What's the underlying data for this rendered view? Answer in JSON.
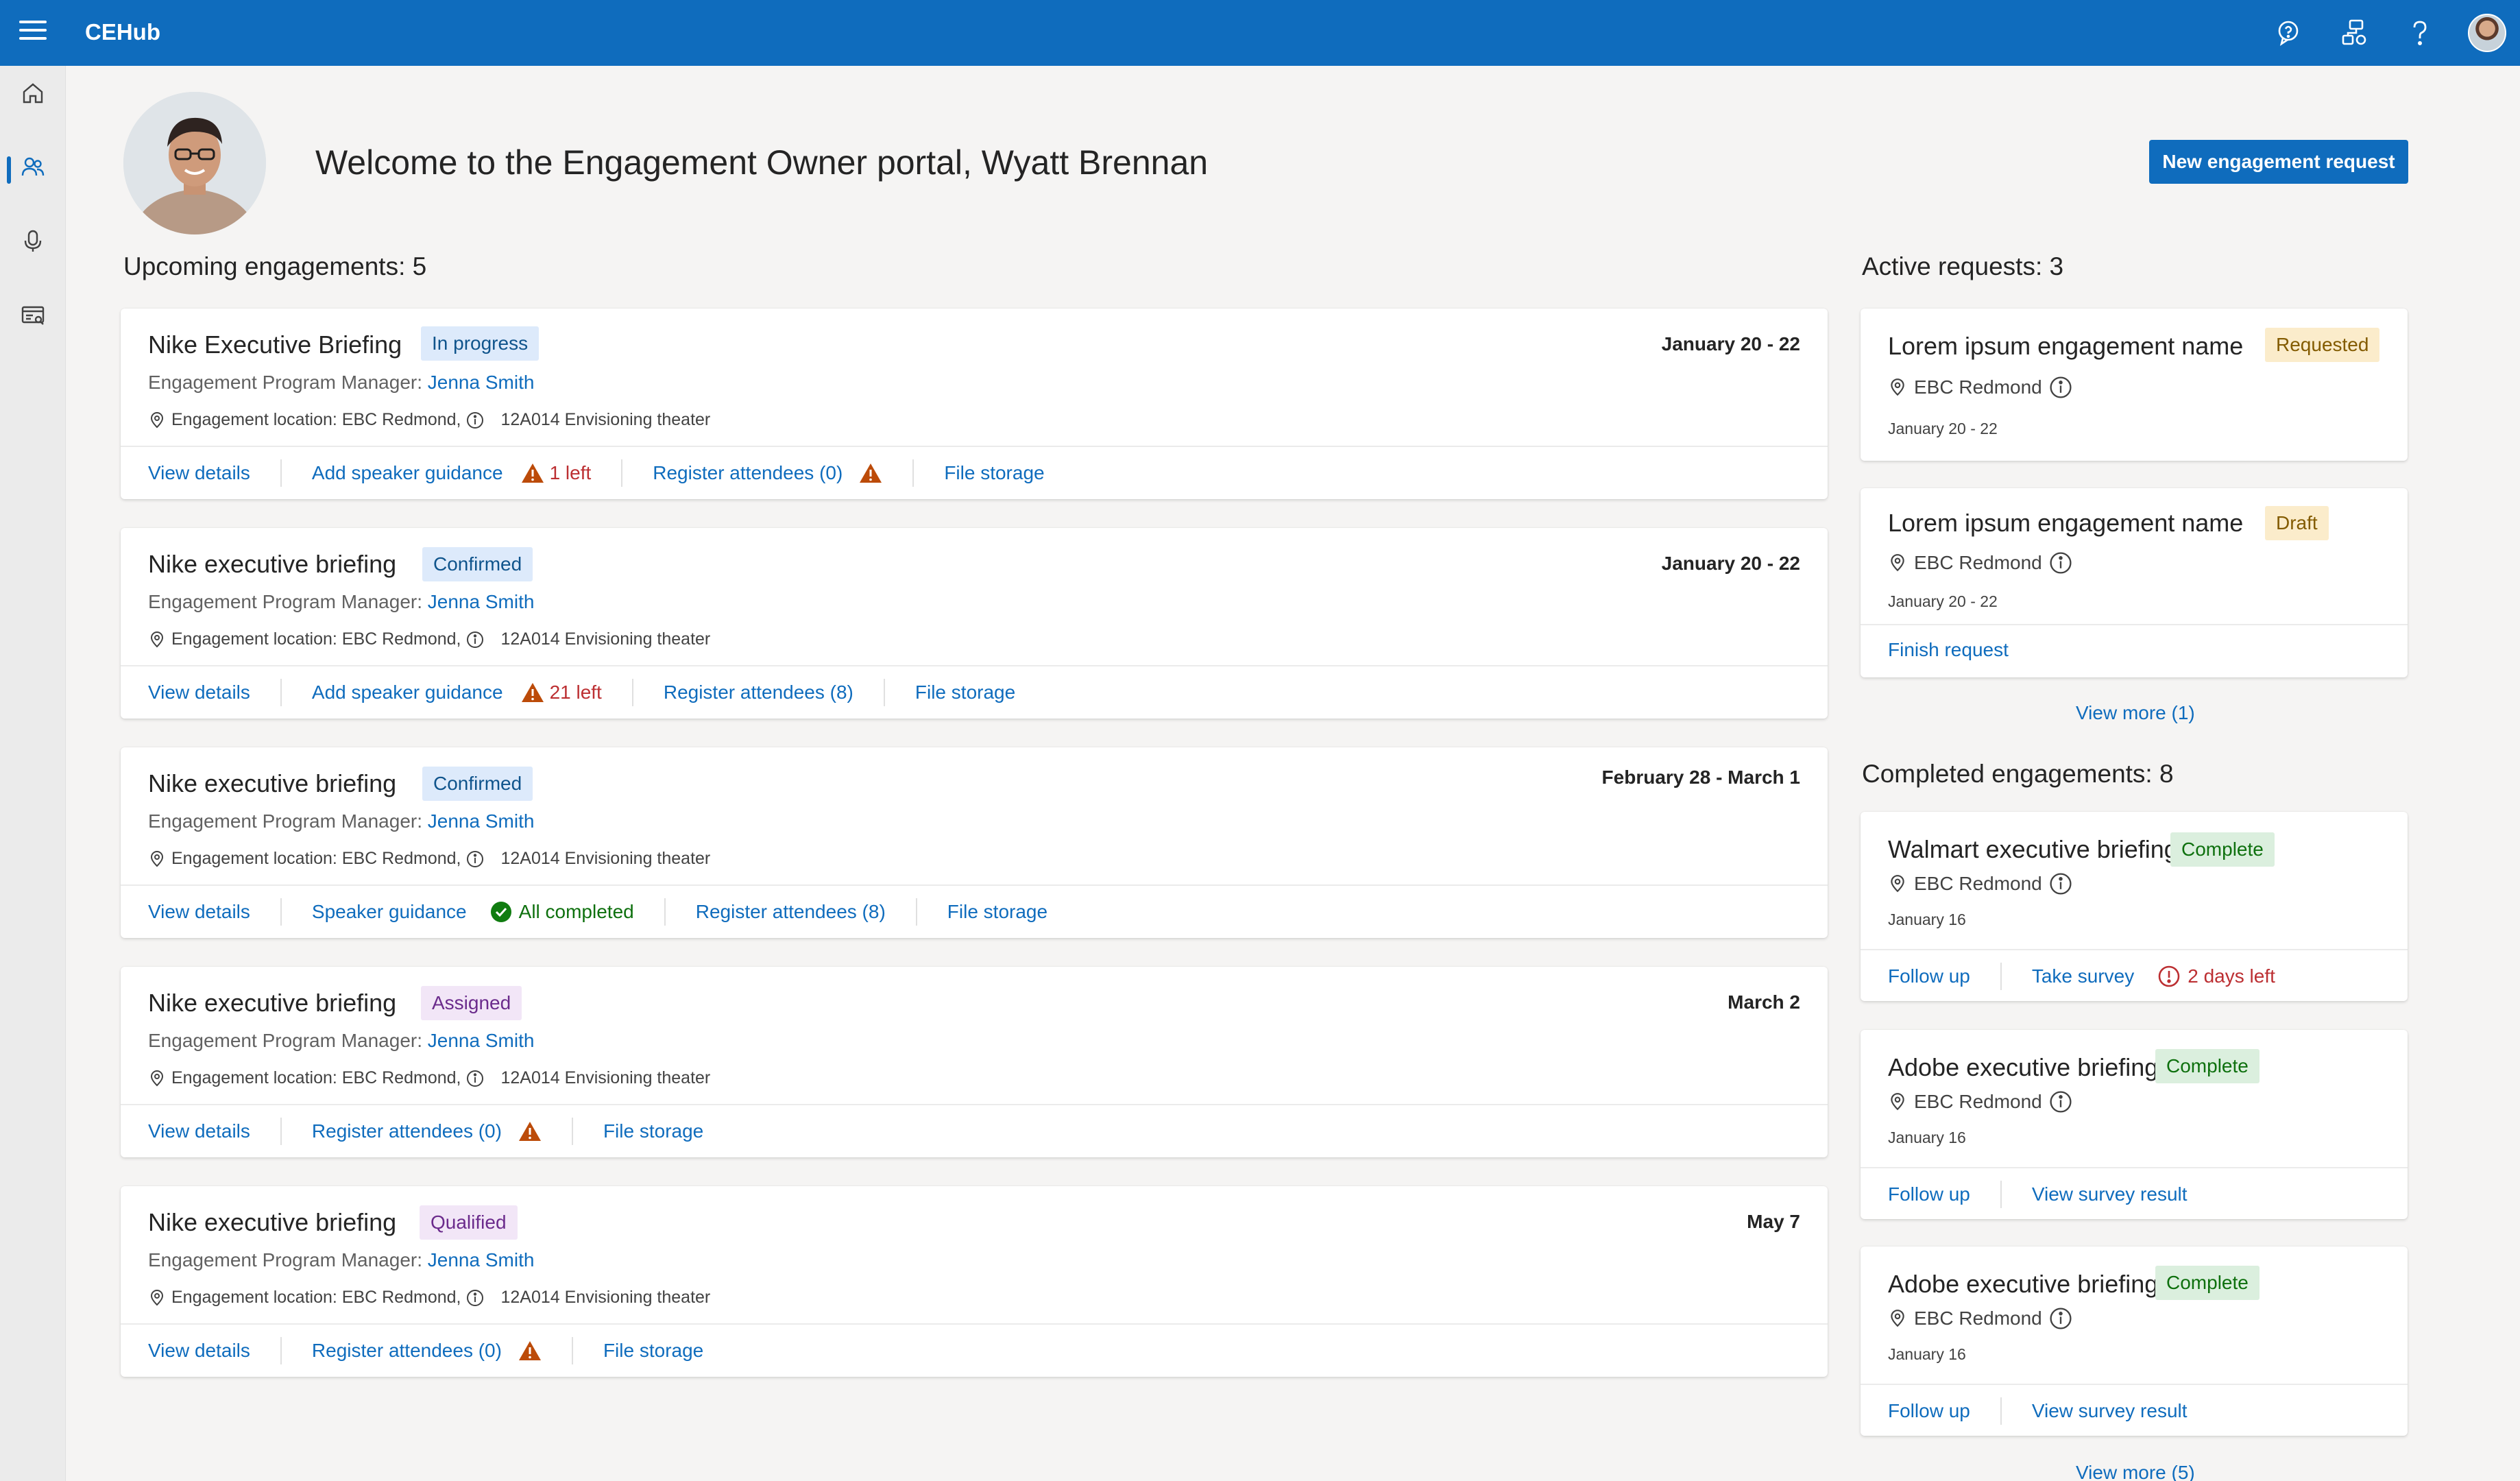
{
  "header": {
    "app_title": "CEHub",
    "icons": [
      "hamburger-icon",
      "chat-help-icon",
      "org-icon",
      "question-icon",
      "avatar"
    ]
  },
  "nav": {
    "items": [
      "home-icon",
      "people-icon",
      "microphone-icon",
      "board-icon"
    ],
    "selected": 1
  },
  "hero": {
    "welcome": "Welcome to the Engagement Owner portal, Wyatt Brennan",
    "new_request_label": "New engagement request"
  },
  "upcoming": {
    "heading": "Upcoming engagements: 5",
    "cards": [
      {
        "title": "Nike Executive Briefing",
        "status": "In progress",
        "date": "January 20 - 22",
        "pm_label": "Engagement Program Manager: ",
        "pm_name": "Jenna Smith",
        "loc_a": "Engagement location: EBC Redmond,",
        "loc_b": "12A014 Envisioning theater",
        "a_details": "View details",
        "a_guidance": "Add speaker guidance",
        "guidance_note": "1 left",
        "a_register": "Register attendees (0)",
        "a_storage": "File storage"
      },
      {
        "title": "Nike executive briefing",
        "status": "Confirmed",
        "date": "January 20 - 22",
        "pm_label": "Engagement Program Manager: ",
        "pm_name": "Jenna Smith",
        "loc_a": "Engagement location: EBC Redmond,",
        "loc_b": "12A014 Envisioning theater",
        "a_details": "View details",
        "a_guidance": "Add speaker guidance",
        "guidance_note": "21 left",
        "a_register": "Register attendees (8)",
        "a_storage": "File storage"
      },
      {
        "title": "Nike executive briefing",
        "status": "Confirmed",
        "date": "February 28 - March 1",
        "pm_label": "Engagement Program Manager: ",
        "pm_name": "Jenna Smith",
        "loc_a": "Engagement location: EBC Redmond,",
        "loc_b": "12A014 Envisioning theater",
        "a_details": "View details",
        "a_guidance": "Speaker guidance",
        "guidance_ok": "All completed",
        "a_register": "Register attendees (8)",
        "a_storage": "File storage"
      },
      {
        "title": "Nike executive briefing",
        "status": "Assigned",
        "date": "March 2",
        "pm_label": "Engagement Program Manager: ",
        "pm_name": "Jenna Smith",
        "loc_a": "Engagement location: EBC Redmond,",
        "loc_b": "12A014 Envisioning theater",
        "a_details": "View details",
        "a_register": "Register attendees (0)",
        "a_storage": "File storage"
      },
      {
        "title": "Nike executive briefing",
        "status": "Qualified",
        "date": "May 7",
        "pm_label": "Engagement Program Manager: ",
        "pm_name": "Jenna Smith",
        "loc_a": "Engagement location: EBC Redmond,",
        "loc_b": "12A014 Envisioning theater",
        "a_details": "View details",
        "a_register": "Register attendees (0)",
        "a_storage": "File storage"
      }
    ]
  },
  "active": {
    "heading": "Active requests: 3",
    "cards": [
      {
        "title": "Lorem ipsum engagement name",
        "status": "Requested",
        "location": "EBC Redmond",
        "date": "January 20 - 22"
      },
      {
        "title": "Lorem ipsum engagement name",
        "status": "Draft",
        "location": "EBC Redmond",
        "date": "January 20 - 22",
        "action": "Finish request"
      }
    ],
    "view_more": "View more (1)"
  },
  "completed": {
    "heading": "Completed engagements: 8",
    "cards": [
      {
        "title": "Walmart executive briefing",
        "status": "Complete",
        "location": "EBC Redmond",
        "date": "January 16",
        "a1": "Follow up",
        "a2": "Take survey",
        "note": "2 days left"
      },
      {
        "title": "Adobe executive briefing",
        "status": "Complete",
        "location": "EBC Redmond",
        "date": "January 16",
        "a1": "Follow up",
        "a2": "View survey result"
      },
      {
        "title": "Adobe executive briefing",
        "status": "Complete",
        "location": "EBC Redmond",
        "date": "January 16",
        "a1": "Follow up",
        "a2": "View survey result"
      }
    ],
    "view_more": "View more (5)"
  },
  "colors": {
    "brand": "#0f6cbd",
    "warning": "#bc4b09",
    "danger": "#bc2f32",
    "success": "#107c10"
  }
}
